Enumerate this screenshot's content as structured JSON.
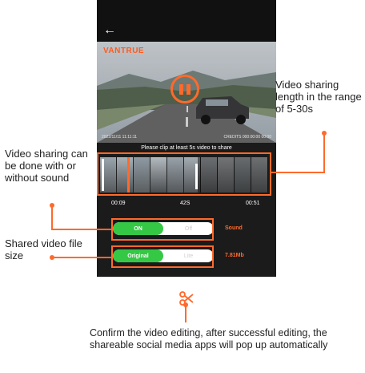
{
  "app": {
    "back_icon": "arrow-left-icon",
    "brand_watermark": "VANTRUE",
    "video_overlay_left": "2022/11/11 11:11:11",
    "video_overlay_right": "CREDITS 000:00:00 00:00",
    "clip_hint": "Please clip at least 5s video to share",
    "timeline": {
      "start_time": "00:09",
      "length": "42S",
      "end_time": "00:51"
    },
    "sound_toggle": {
      "on_label": "ON",
      "off_label": "Off",
      "state": "ON",
      "label": "Sound"
    },
    "size_toggle": {
      "on_label": "Original",
      "off_label": "Lite",
      "state": "Original",
      "label": "7.81Mb"
    },
    "confirm_icon": "scissors-icon"
  },
  "annotations": {
    "length_note": "Video sharing length in the range of 5-30s",
    "sound_note": "Video sharing can be done with or without sound",
    "size_note": "Shared video file size",
    "confirm_note": "Confirm the video editing, after successful editing, the shareable social media apps will pop up automatically"
  },
  "colors": {
    "accent": "#ff6a2b",
    "toggle_on": "#35c845",
    "app_background": "#1b1b1b"
  }
}
